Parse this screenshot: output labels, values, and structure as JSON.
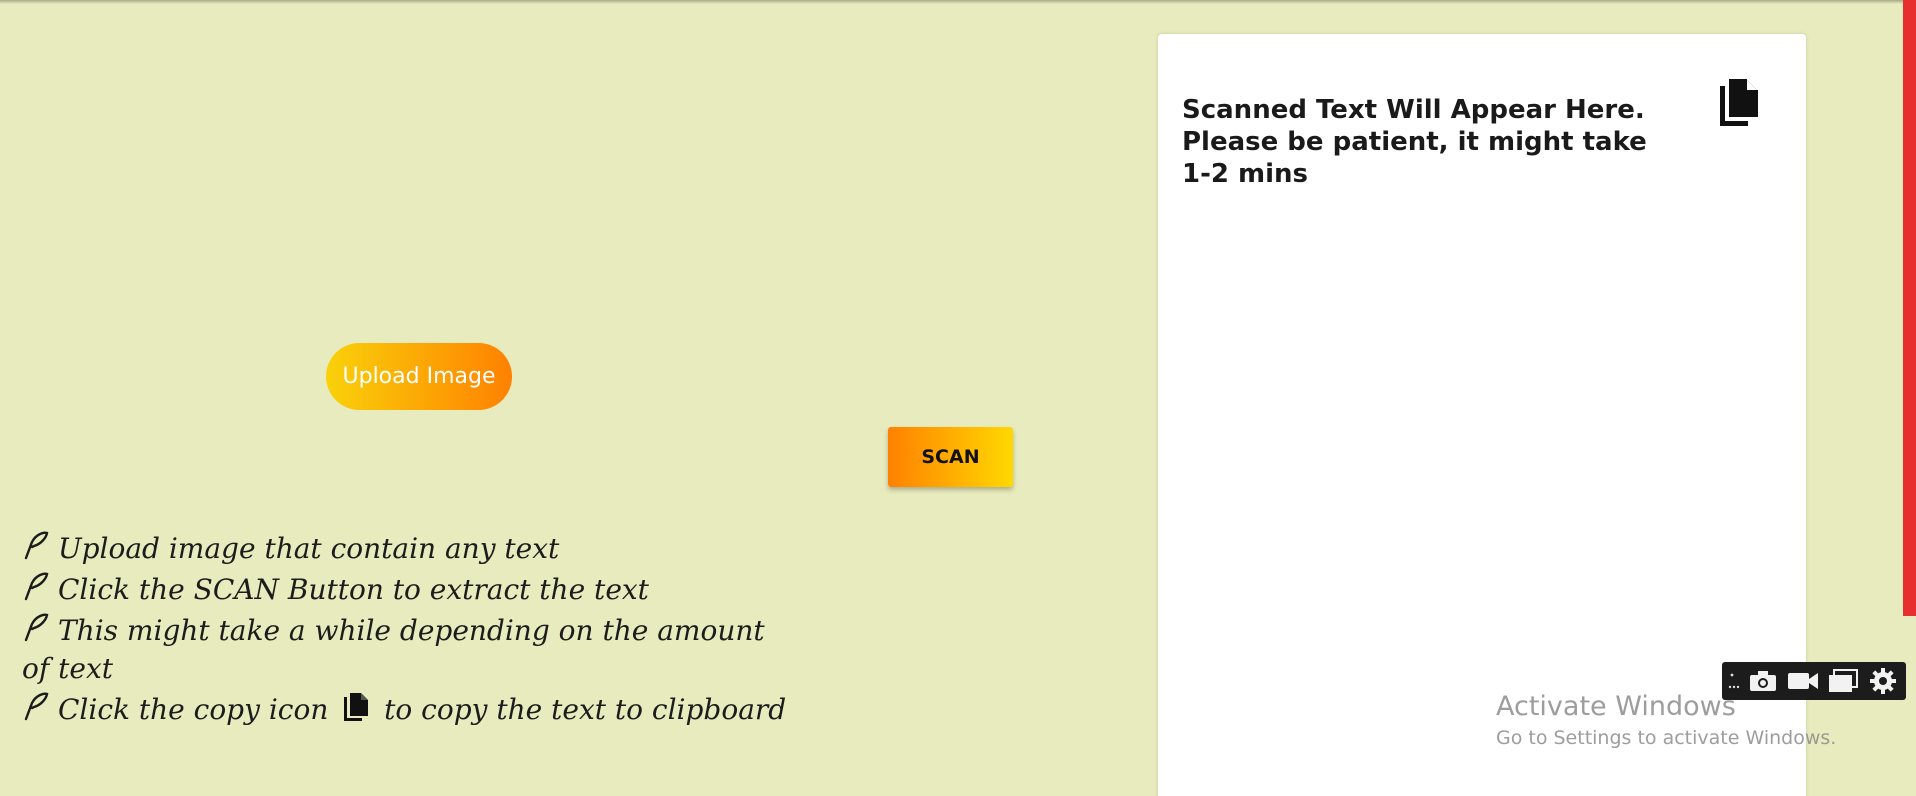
{
  "upload": {
    "label": "Upload Image"
  },
  "scan": {
    "label": "SCAN"
  },
  "instructions": {
    "items": [
      "Upload image that contain any text",
      "Click the SCAN Button to extract the text",
      "This might take a while depending on the amount of text"
    ],
    "copy_before": "Click the copy icon",
    "copy_after": "to copy the text to clipboard"
  },
  "result": {
    "placeholder": "Scanned Text Will Appear Here. Please be patient, it might take 1-2 mins"
  },
  "watermark": {
    "title": "Activate Windows",
    "subtitle": "Go to Settings to activate Windows."
  },
  "colors": {
    "background": "#e8ebbd",
    "accent_yellow": "#f9d10a",
    "accent_orange": "#ff8100",
    "edge_red": "#e82f2f"
  },
  "icons": [
    "feather-icon",
    "copy-icon",
    "camera-icon",
    "video-icon",
    "window-icon",
    "gear-icon"
  ]
}
